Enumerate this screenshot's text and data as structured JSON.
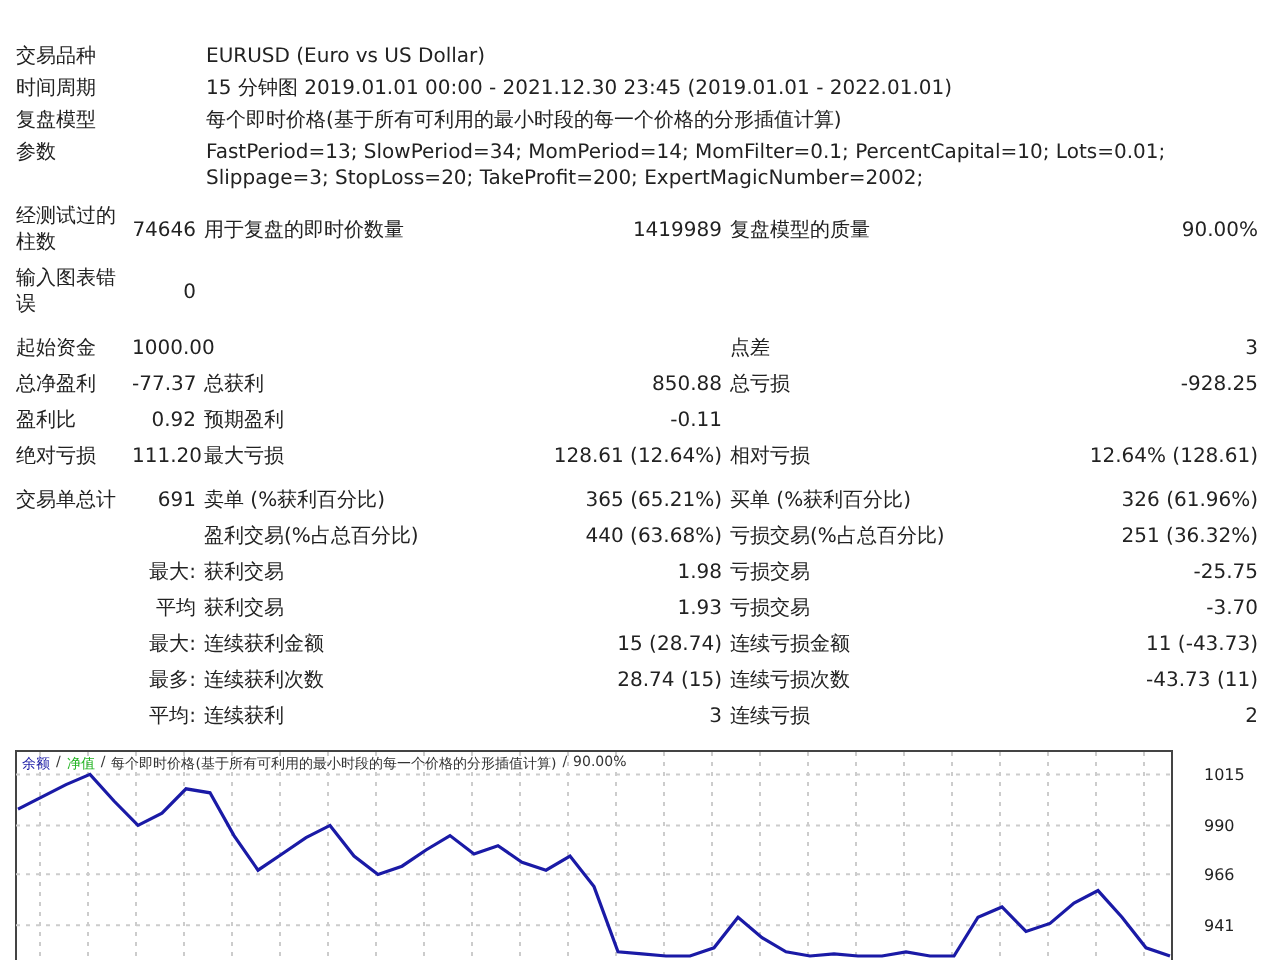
{
  "info": [
    {
      "label": "交易品种",
      "value": "EURUSD (Euro vs US Dollar)"
    },
    {
      "label": "时间周期",
      "value": "15 分钟图 2019.01.01 00:00 - 2021.12.30 23:45 (2019.01.01 - 2022.01.01)"
    },
    {
      "label": "复盘模型",
      "value": "每个即时价格(基于所有可利用的最小时段的每一个价格的分形插值计算)"
    },
    {
      "label": "参数",
      "value": "FastPeriod=13; SlowPeriod=34; MomPeriod=14; MomFilter=0.1; PercentCapital=10; Lots=0.01; Slippage=3; StopLoss=20; TakeProfit=200; ExpertMagicNumber=2002;"
    }
  ],
  "sections": [
    [
      {
        "label": "经测试过的柱数",
        "value": "74646",
        "cells": [
          {
            "label": "用于复盘的即时价数量",
            "value": "1419989"
          },
          {
            "label": "复盘模型的质量",
            "value": "90.00%"
          }
        ]
      },
      {
        "label": "输入图表错误",
        "value": "0"
      }
    ],
    [
      {
        "label": "起始资金",
        "value": "1000.00",
        "cells": [
          {},
          {
            "label": "点差",
            "value": "3"
          }
        ]
      },
      {
        "label": "总净盈利",
        "value": "-77.37",
        "cells": [
          {
            "label": "总获利",
            "value": "850.88"
          },
          {
            "label": "总亏损",
            "value": "-928.25"
          }
        ]
      },
      {
        "label": "盈利比",
        "value": "0.92",
        "cells": [
          {
            "label": "预期盈利",
            "value": "-0.11"
          }
        ]
      },
      {
        "label": "绝对亏损",
        "value": "111.20",
        "cells": [
          {
            "label": "最大亏损",
            "value": "128.61 (12.64%)"
          },
          {
            "label": "相对亏损",
            "value": "12.64% (128.61)"
          }
        ]
      }
    ],
    [
      {
        "label": "交易单总计",
        "value": "691",
        "cells": [
          {
            "label": "卖单 (%获利百分比)",
            "value": "365 (65.21%)"
          },
          {
            "label": "买单 (%获利百分比)",
            "value": "326 (61.96%)"
          }
        ]
      },
      {
        "cells": [
          {
            "label": "盈利交易(%占总百分比)",
            "value": "440 (63.68%)"
          },
          {
            "label": "亏损交易(%占总百分比)",
            "value": "251 (36.32%)"
          }
        ]
      },
      {
        "value": "最大:",
        "cells": [
          {
            "label": "获利交易",
            "value": "1.98"
          },
          {
            "label": "亏损交易",
            "value": "-25.75"
          }
        ]
      },
      {
        "value": "平均",
        "cells": [
          {
            "label": "获利交易",
            "value": "1.93"
          },
          {
            "label": "亏损交易",
            "value": "-3.70"
          }
        ]
      },
      {
        "value": "最大:",
        "cells": [
          {
            "label": "连续获利金额",
            "value": "15 (28.74)"
          },
          {
            "label": "连续亏损金额",
            "value": "11 (-43.73)"
          }
        ]
      },
      {
        "value": "最多:",
        "cells": [
          {
            "label": "连续获利次数",
            "value": "28.74 (15)"
          },
          {
            "label": "连续亏损次数",
            "value": "-43.73 (11)"
          }
        ]
      },
      {
        "value": "平均:",
        "cells": [
          {
            "label": "连续获利",
            "value": "3"
          },
          {
            "label": "连续亏损",
            "value": "2"
          }
        ]
      }
    ]
  ],
  "chart": {
    "legend": [
      {
        "text": "/"
      },
      {
        "text": "净值",
        "color": "#22b422"
      },
      {
        "text": "/"
      },
      {
        "text": "每个即时价格(基于所有可利用的最小时段的每一个价格的分形插值计算)"
      },
      {
        "text": "/"
      },
      {
        "text": "90.00%"
      }
    ],
    "chart_data": {
      "type": "line",
      "grid": true,
      "ylim": [
        924,
        1027
      ],
      "yticks": [
        1015,
        990,
        966,
        941
      ],
      "series": [
        {
          "name": "余额",
          "color": "#1a1aa6",
          "values": [
            998,
            1004,
            1010,
            1015,
            1002,
            990,
            996,
            1008,
            1006,
            985,
            968,
            976,
            984,
            990,
            975,
            966,
            970,
            978,
            985,
            976,
            980,
            972,
            968,
            975,
            960,
            928,
            927,
            926,
            926,
            930,
            945,
            935,
            928,
            926,
            927,
            926,
            926,
            928,
            926,
            926,
            945,
            950,
            938,
            942,
            952,
            958,
            945,
            930,
            926
          ]
        }
      ]
    }
  }
}
